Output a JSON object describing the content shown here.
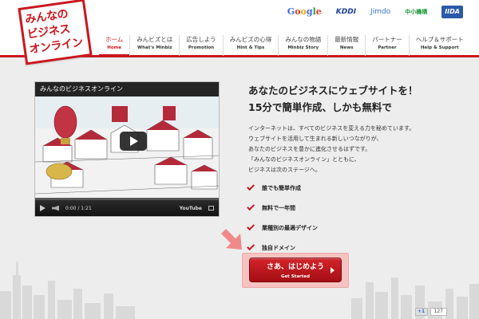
{
  "logo": {
    "lines": [
      "みんなの",
      "ビジネス",
      "オンライン"
    ]
  },
  "partners": [
    "Google",
    "KDDI",
    "Jimdo",
    "中小機構",
    "IIDA"
  ],
  "nav": [
    {
      "jp": "ホーム",
      "en": "Home",
      "active": true
    },
    {
      "jp": "みんビズとは",
      "en": "What's Minbiz"
    },
    {
      "jp": "広告しよう",
      "en": "Promotion"
    },
    {
      "jp": "みんビズの心得",
      "en": "Hint & Tips"
    },
    {
      "jp": "みんなの物語",
      "en": "Minbiz Story"
    },
    {
      "jp": "最新情報",
      "en": "News"
    },
    {
      "jp": "パートナー",
      "en": "Partner"
    },
    {
      "jp": "ヘルプ＆サポート",
      "en": "Help & Support"
    }
  ],
  "video": {
    "title": "みんなのビジネスオンライン",
    "time": "0:00 / 1:21",
    "brand": "YouTube",
    "progress": 0
  },
  "headline": {
    "line1": "あなたのビジネスにウェブサイトを！",
    "line2": "15分で簡単作成、しかも無料で"
  },
  "intro": [
    "インターネットは、すべてのビジネスを変える力を秘めています。",
    "ウェブサイトを活用して生まれる新しいつながりが、",
    "あなたのビジネスを豊かに進化させるはずです。",
    "「みんなのビジネスオンライン」とともに、",
    "ビジネスは次のステージへ。"
  ],
  "features": [
    "誰でも簡単作成",
    "無料で一年間",
    "業種別の最適デザイン",
    "独自ドメイン"
  ],
  "cta": {
    "main": "さあ、はじめよう",
    "sub": "Get Started"
  },
  "social": {
    "icon_label": "+1",
    "count": "127"
  },
  "colors": {
    "brand_red": "#c9171e",
    "background": "#ededed"
  }
}
